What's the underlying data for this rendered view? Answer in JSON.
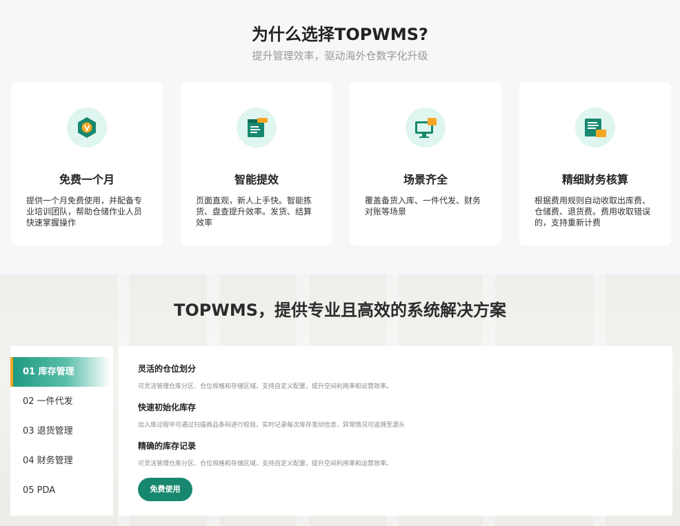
{
  "why": {
    "title": "为什么选择TOPWMS?",
    "subtitle": "提升管理效率，驱动海外仓数字化升级",
    "cards": [
      {
        "icon": "v-badge-icon",
        "title": "免费一个月",
        "desc": "提供一个月免费使用，并配备专业培训团队，帮助仓储作业人员快速掌握操作"
      },
      {
        "icon": "browser-window-icon",
        "title": "智能提效",
        "desc": "页面直观，新人上手快。智能拣货、盘查提升效率。发货、结算效率"
      },
      {
        "icon": "monitor-icon",
        "title": "场景齐全",
        "desc": "覆盖备货入库、一件代发、财务对账等场景"
      },
      {
        "icon": "finance-document-icon",
        "title": "精细财务核算",
        "desc": "根据费用规则自动收取出库费、仓储费、退货费。费用收取错误的，支持重新计费"
      }
    ]
  },
  "solution": {
    "title": "TOPWMS，提供专业且高效的系统解决方案",
    "tabs": [
      {
        "label": "01 库存管理",
        "active": true
      },
      {
        "label": "02 一件代发",
        "active": false
      },
      {
        "label": "03 退货管理",
        "active": false
      },
      {
        "label": "04 财务管理",
        "active": false
      },
      {
        "label": "05 PDA",
        "active": false
      }
    ],
    "features": [
      {
        "title": "灵活的仓位划分",
        "desc": "可灵活管理仓库分区、仓位规格和存储区域，支持自定义配置，提升空间利用率和运营效率。"
      },
      {
        "title": "快速初始化库存",
        "desc": "出入库过程中可通过扫描商品条码进行校验，实时记录每次库存变动信息，异常情况可追溯至源头"
      },
      {
        "title": "精确的库存记录",
        "desc": "可灵活管理仓库分区、仓位规格和存储区域，支持自定义配置，提升空间利用率和运营效率。"
      }
    ],
    "button_label": "免费使用"
  },
  "colors": {
    "brand_green": "#17886f",
    "accent_orange": "#f5a623",
    "icon_bg": "#dff5ef"
  }
}
